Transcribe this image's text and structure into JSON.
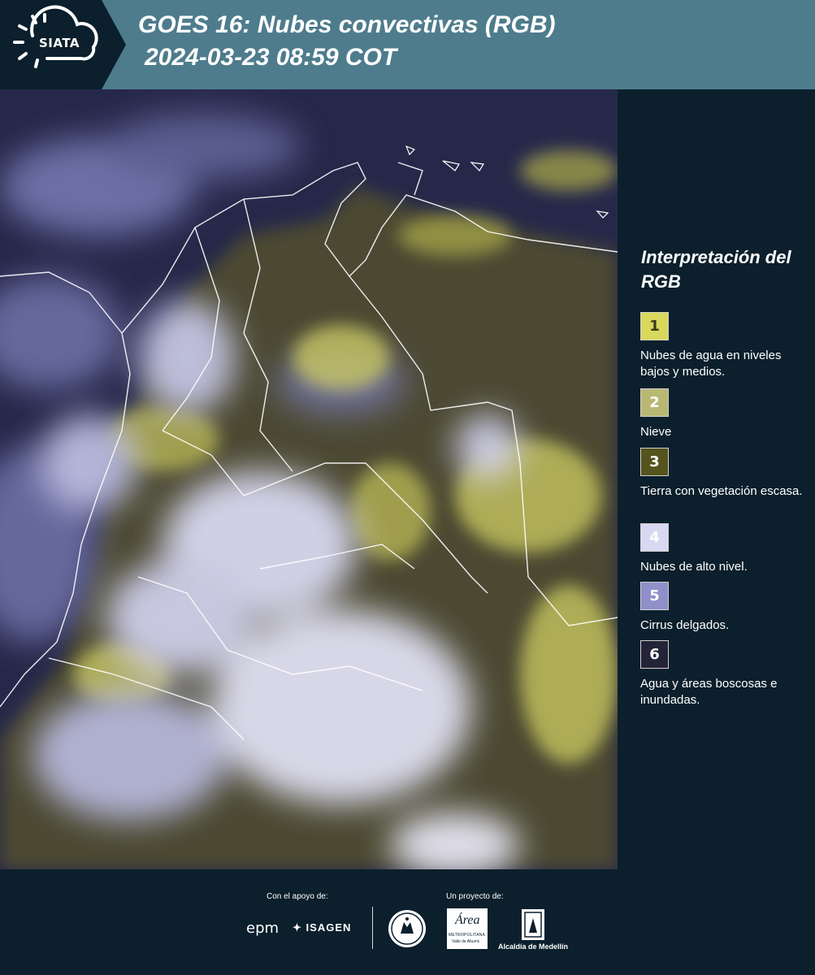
{
  "header": {
    "logo_text": "SIATA",
    "title": "GOES 16: Nubes convectivas (RGB)",
    "datetime": "2024-03-23 08:59 COT"
  },
  "legend": {
    "title": "Interpretación del RGB",
    "items": [
      {
        "number": "1",
        "label": "Nubes de agua en niveles bajos y medios.",
        "color": "#d9d75c",
        "text_color": "#3a3a1a"
      },
      {
        "number": "2",
        "label": "Nieve",
        "color": "#b9b873",
        "text_color": "#ffffff"
      },
      {
        "number": "3",
        "label": "Tierra con vegetación escasa.",
        "color": "#55541c",
        "text_color": "#ffffff"
      },
      {
        "number": "4",
        "label": "Nubes de alto nivel.",
        "color": "#d8d8f2",
        "text_color": "#ffffff"
      },
      {
        "number": "5",
        "label": "Cirrus delgados.",
        "color": "#8f90c9",
        "text_color": "#ffffff"
      },
      {
        "number": "6",
        "label": "Agua y áreas boscosas e inundadas.",
        "color": "#252338",
        "text_color": "#ffffff"
      }
    ]
  },
  "footer": {
    "support_label": "Con el apoyo de:",
    "project_label": "Un proyecto de:",
    "sponsors": [
      "epm",
      "ISAGEN"
    ],
    "partners": [
      "Metropolitana Valle de Aburrá",
      "Alcaldía de Medellín"
    ],
    "area_text": "Área",
    "metro_text": "METROPOLITANA",
    "valle_text": "Valle de Aburrá"
  },
  "colors": {
    "header_bg": "#4e7c8c",
    "panel_bg": "#0b1f2c",
    "water": "#26284a",
    "land": "#4b4a30",
    "cloud_low": "#cfcd62",
    "cloud_high": "#dcdcf5",
    "cirrus": "#8486c4"
  }
}
